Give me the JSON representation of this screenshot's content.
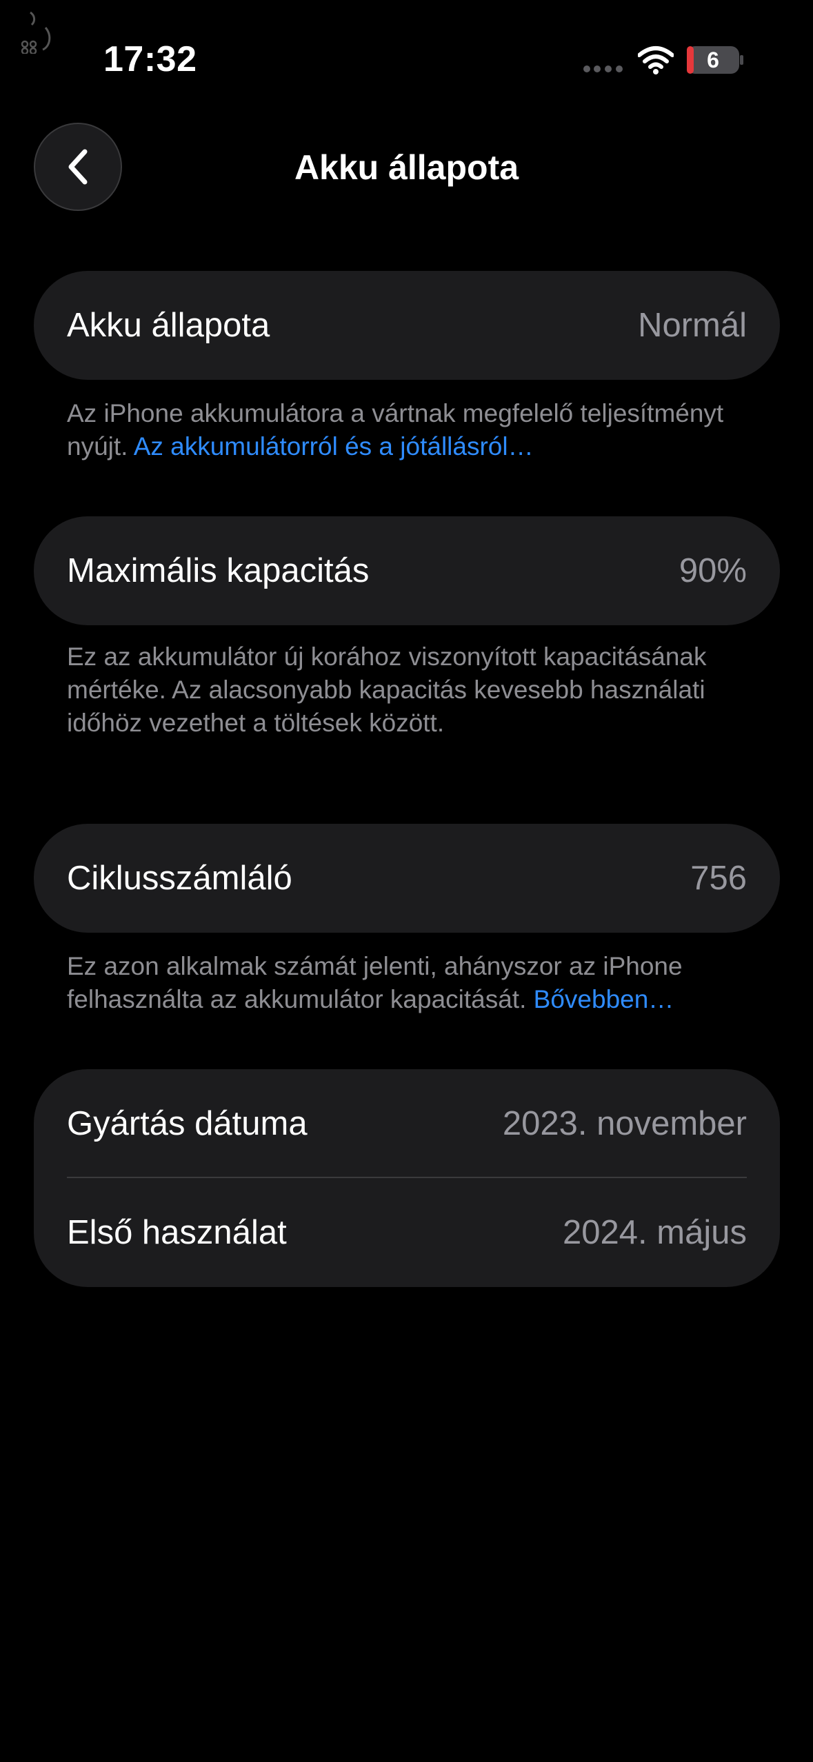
{
  "status_bar": {
    "time": "17:32",
    "battery_level": "6",
    "icons": [
      "corner-logo-icon",
      "signal-dots-icon",
      "wifi-icon",
      "battery-icon"
    ],
    "battery_low_color": "#e5383b"
  },
  "nav": {
    "title": "Akku állapota",
    "back_icon": "chevron-left-icon"
  },
  "health": {
    "label": "Akku állapota",
    "value": "Normál",
    "footnote_text": "Az iPhone akkumulátora a vártnak megfelelő teljesítményt nyújt. ",
    "footnote_link": "Az akkumulátorról és a jótállásról…"
  },
  "capacity": {
    "label": "Maximális kapacitás",
    "value": "90%",
    "footnote_text": "Ez az akkumulátor új korához viszonyított kapacitásának mértéke. Az alacsonyabb kapacitás kevesebb használati időhöz vezethet a töltések között."
  },
  "cycles": {
    "label": "Ciklusszámláló",
    "value": "756",
    "footnote_text": "Ez azon alkalmak számát jelenti, ahányszor az iPhone felhasználta az akkumulátor kapacitását. ",
    "footnote_link": "Bővebben…"
  },
  "dates": {
    "manufacture_label": "Gyártás dátuma",
    "manufacture_value": "2023. november",
    "first_use_label": "Első használat",
    "first_use_value": "2024. május"
  },
  "colors": {
    "background": "#000000",
    "card": "#1c1c1e",
    "secondary_text": "#98989f",
    "link": "#2f8cff"
  }
}
